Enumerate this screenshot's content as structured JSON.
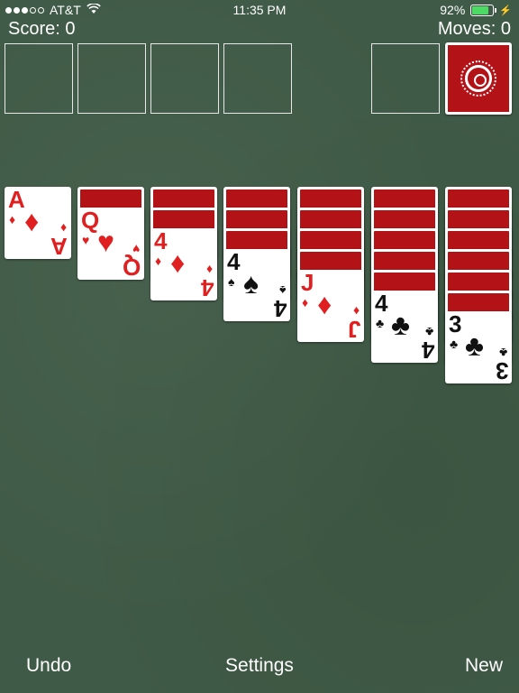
{
  "status_bar": {
    "carrier": "AT&T",
    "time": "11:35 PM",
    "battery": "92%",
    "battery_level": 0.92
  },
  "header": {
    "score": "Score: 0",
    "moves": "Moves: 0"
  },
  "foundations": [
    "empty",
    "empty",
    "empty",
    "empty"
  ],
  "waste": "empty",
  "stock": {
    "icon": "card-back-emblem-icon"
  },
  "tableau": [
    {
      "face_down": 0,
      "face_up": {
        "rank": "A",
        "suit": "♦",
        "color": "red"
      }
    },
    {
      "face_down": 1,
      "face_up": {
        "rank": "Q",
        "suit": "♥",
        "color": "red"
      }
    },
    {
      "face_down": 2,
      "face_up": {
        "rank": "4",
        "suit": "♦",
        "color": "red"
      }
    },
    {
      "face_down": 3,
      "face_up": {
        "rank": "4",
        "suit": "♠",
        "color": "black"
      }
    },
    {
      "face_down": 4,
      "face_up": {
        "rank": "J",
        "suit": "♦",
        "color": "red"
      }
    },
    {
      "face_down": 5,
      "face_up": {
        "rank": "4",
        "suit": "♣",
        "color": "black"
      }
    },
    {
      "face_down": 6,
      "face_up": {
        "rank": "3",
        "suit": "♣",
        "color": "black"
      }
    }
  ],
  "toolbar": {
    "undo": "Undo",
    "settings": "Settings",
    "new": "New"
  },
  "colors": {
    "table_green": "#3f5a46",
    "card_back_red": "#b31217",
    "suit_red": "#e02020",
    "battery_green": "#4cd964"
  }
}
